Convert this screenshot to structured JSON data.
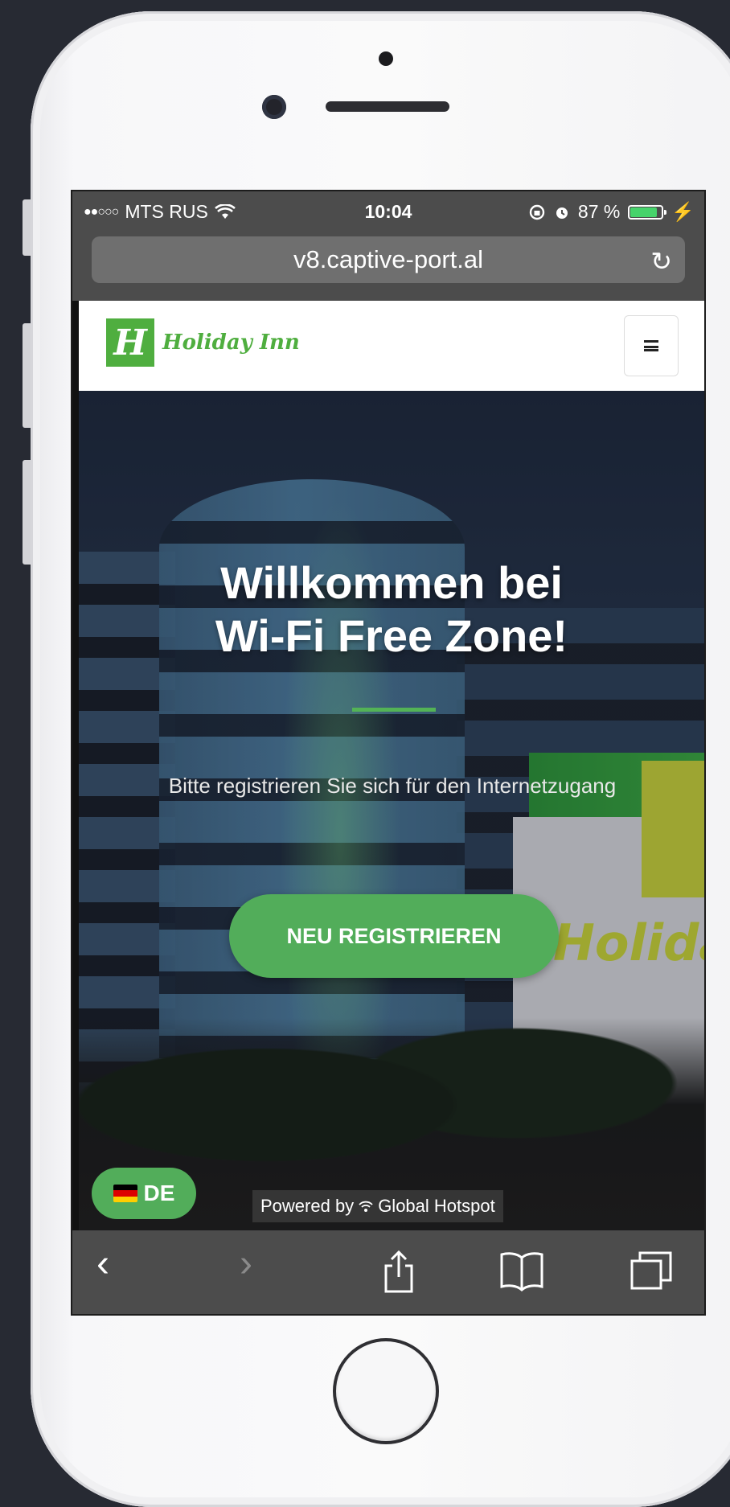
{
  "status_bar": {
    "carrier": "MTS RUS",
    "time": "10:04",
    "battery_text": "87 %",
    "battery_level": 0.87
  },
  "browser": {
    "url": "v8.captive-port.al"
  },
  "navbar": {
    "logo_mark": "H",
    "logo_text": "Holiday Inn"
  },
  "hero": {
    "title_line1": "Willkommen bei",
    "title_line2": "Wi-Fi Free Zone!",
    "subtitle": "Bitte registrieren Sie sich für den Internetzugang",
    "cta_label": "NEU REGISTRIEREN",
    "background_sign": "Holida"
  },
  "footer": {
    "language": "DE",
    "powered_by": "Powered by",
    "provider": "Global Hotspot"
  },
  "colors": {
    "brand_green": "#52ad5a",
    "logo_green": "#4fae3f",
    "flag": [
      "#000000",
      "#dd0000",
      "#ffce00"
    ]
  },
  "icons": {
    "back": "chevron-left-icon",
    "forward": "chevron-right-icon",
    "share": "share-icon",
    "bookmarks": "book-icon",
    "tabs": "tabs-icon",
    "reload": "reload-icon",
    "menu": "hamburger-icon"
  }
}
